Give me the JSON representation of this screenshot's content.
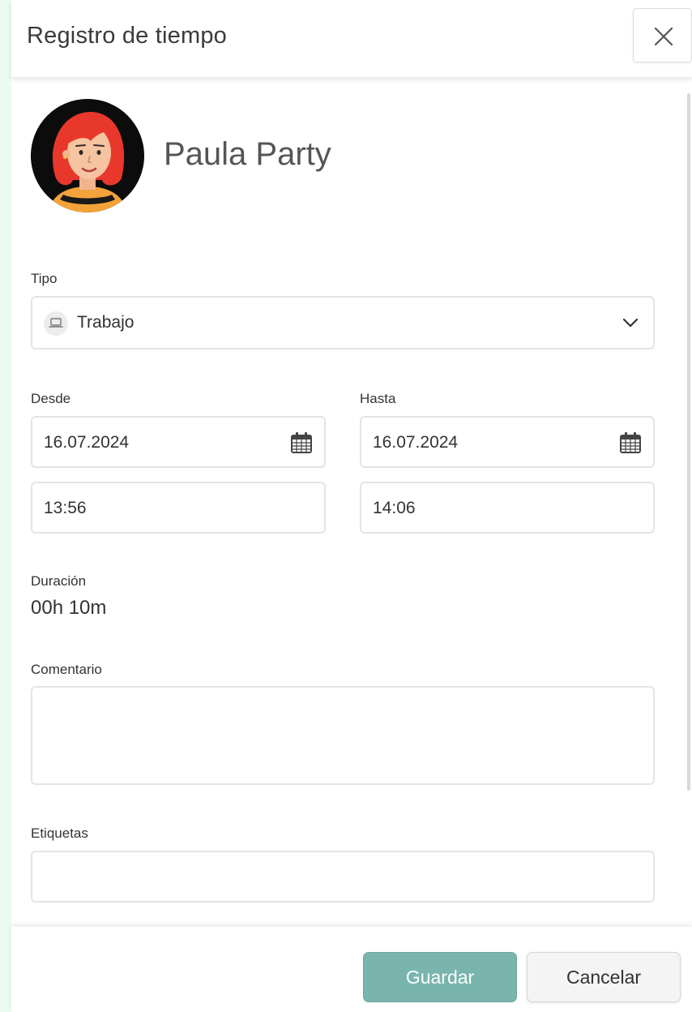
{
  "header": {
    "title": "Registro de tiempo",
    "close_icon": "close-icon"
  },
  "user": {
    "name": "Paula Party",
    "avatar": "avatar-woman-red-hair"
  },
  "form": {
    "tipo": {
      "label": "Tipo",
      "value": "Trabajo",
      "icon": "laptop-icon"
    },
    "desde": {
      "label": "Desde",
      "date": "16.07.2024",
      "time": "13:56"
    },
    "hasta": {
      "label": "Hasta",
      "date": "16.07.2024",
      "time": "14:06"
    },
    "duracion": {
      "label": "Duración",
      "value": "00h 10m"
    },
    "comentario": {
      "label": "Comentario",
      "value": ""
    },
    "etiquetas": {
      "label": "Etiquetas",
      "value": ""
    }
  },
  "footer": {
    "save_label": "Guardar",
    "cancel_label": "Cancelar"
  },
  "colors": {
    "accent": "#79b5ad",
    "background": "#eafbf2"
  }
}
